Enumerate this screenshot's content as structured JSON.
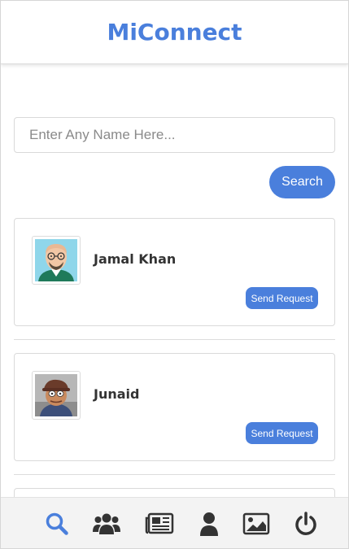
{
  "header": {
    "title": "MiConnect"
  },
  "search": {
    "placeholder": "Enter Any Name Here...",
    "value": "",
    "button_label": "Search"
  },
  "results": [
    {
      "name": "Jamal Khan",
      "action_label": "Send Request",
      "avatar": "cartoon-man-glasses-avatar"
    },
    {
      "name": "Junaid",
      "action_label": "Send Request",
      "avatar": "cartoon-man-cap-avatar"
    }
  ],
  "bottom_nav": {
    "items": [
      {
        "icon": "search-icon",
        "active": true
      },
      {
        "icon": "users-icon",
        "active": false
      },
      {
        "icon": "newspaper-icon",
        "active": false
      },
      {
        "icon": "user-icon",
        "active": false
      },
      {
        "icon": "image-icon",
        "active": false
      },
      {
        "icon": "power-icon",
        "active": false
      }
    ]
  },
  "colors": {
    "accent": "#4a7fdc",
    "nav_bg": "#f3f3f3",
    "icon_dark": "#333333"
  }
}
